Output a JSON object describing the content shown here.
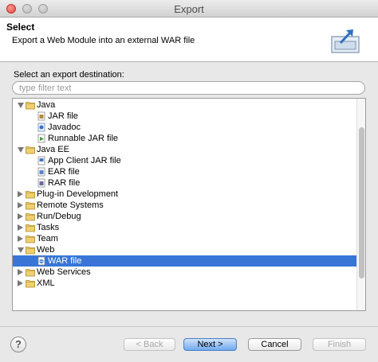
{
  "window": {
    "title": "Export"
  },
  "header": {
    "title": "Select",
    "description": "Export a Web Module into an external WAR file",
    "icon": "export-wizard-icon"
  },
  "destination_label": "Select an export destination:",
  "filter": {
    "placeholder": "type filter text",
    "value": ""
  },
  "tree": [
    {
      "label": "Java",
      "kind": "folder",
      "expanded": true,
      "level": 0
    },
    {
      "label": "JAR file",
      "kind": "jar-file-icon",
      "level": 1
    },
    {
      "label": "Javadoc",
      "kind": "javadoc-icon",
      "level": 1
    },
    {
      "label": "Runnable JAR file",
      "kind": "runnable-jar-icon",
      "level": 1
    },
    {
      "label": "Java EE",
      "kind": "folder",
      "expanded": true,
      "level": 0
    },
    {
      "label": "App Client JAR file",
      "kind": "app-client-jar-icon",
      "level": 1
    },
    {
      "label": "EAR file",
      "kind": "ear-file-icon",
      "level": 1
    },
    {
      "label": "RAR file",
      "kind": "rar-file-icon",
      "level": 1
    },
    {
      "label": "Plug-in Development",
      "kind": "folder",
      "expanded": false,
      "level": 0
    },
    {
      "label": "Remote Systems",
      "kind": "folder",
      "expanded": false,
      "level": 0
    },
    {
      "label": "Run/Debug",
      "kind": "folder",
      "expanded": false,
      "level": 0
    },
    {
      "label": "Tasks",
      "kind": "folder",
      "expanded": false,
      "level": 0
    },
    {
      "label": "Team",
      "kind": "folder",
      "expanded": false,
      "level": 0
    },
    {
      "label": "Web",
      "kind": "folder",
      "expanded": true,
      "level": 0
    },
    {
      "label": "WAR file",
      "kind": "war-file-icon",
      "level": 1,
      "selected": true
    },
    {
      "label": "Web Services",
      "kind": "folder",
      "expanded": false,
      "level": 0
    },
    {
      "label": "XML",
      "kind": "folder",
      "expanded": false,
      "level": 0
    }
  ],
  "buttons": {
    "help": "?",
    "back": "< Back",
    "next": "Next >",
    "cancel": "Cancel",
    "finish": "Finish"
  },
  "colors": {
    "selection": "#3875d7",
    "folder": "#e8c25a"
  }
}
